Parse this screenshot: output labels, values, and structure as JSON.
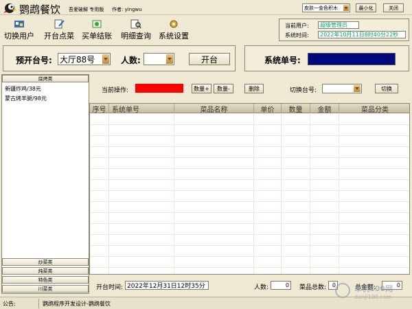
{
  "titlebar": {
    "app_name": "鹦鹉餐饮",
    "subtitle": "吾爱破解 专用版",
    "author": "作者: yingwu",
    "skin_value": "皮肤一金色积木",
    "minimize_label": "最小化",
    "close_label": "关闭"
  },
  "toolbar": {
    "switch_user": "切换用户",
    "open_order": "开台点菜",
    "checkout": "买单结账",
    "detail_query": "明细查询",
    "settings": "系统设置"
  },
  "userinfo": {
    "current_user_label": "当前用户:",
    "current_user_value": "超级管理员",
    "system_time_label": "系统时间:",
    "system_time_value": "2022年10月11日8时40分22秒"
  },
  "openbar": {
    "table_label": "预开台号:",
    "table_value": "大厅88号",
    "people_label": "人数:",
    "people_value": "",
    "open_button": "开台",
    "order_no_label": "系统单号:",
    "order_no_color": "#000a7e"
  },
  "categories": {
    "top": "烧烤类",
    "items": [
      "新疆炸鸡/38元",
      "蒙古烤羊腿/98元"
    ],
    "bottom": [
      "炒菜类",
      "炖菜类",
      "特色类",
      "川菜类"
    ]
  },
  "operation": {
    "current_op_label": "当前操作:",
    "current_op_color": "#ff0000",
    "qty_plus": "数量+",
    "qty_minus": "数量-",
    "delete": "删除",
    "switch_table_label": "切换台号:",
    "switch_table_value": "",
    "switch_button": "切换"
  },
  "table": {
    "columns": [
      "序号",
      "系统单号",
      "菜品名称",
      "单价",
      "数量",
      "金额",
      "菜品分类"
    ]
  },
  "footer": {
    "open_time_label": "开台时间:",
    "open_time_value": "2022年12月31日12时35分",
    "people_label": "人数:",
    "people_value": "0",
    "dish_total_label": "菜品总数:",
    "dish_total_value": "0",
    "amount_label": "总金额:",
    "amount_value": "0"
  },
  "statusbar": {
    "notice_label": "公告:",
    "notice_value": "鹦鹉程序开发设计-鹦鹉餐饮"
  },
  "watermark": {
    "text": "danji100.com",
    "site": "单机100网"
  }
}
